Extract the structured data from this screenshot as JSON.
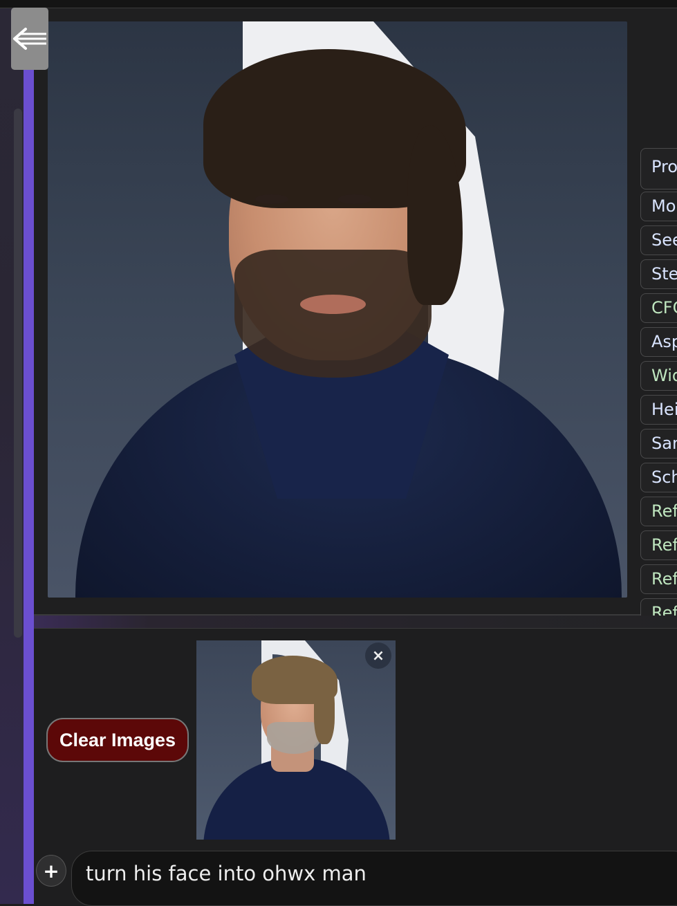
{
  "header": {
    "back_icon": "back-arrow-icon"
  },
  "generated_image": {
    "alt": "Generated portrait of a bearded man in a navy shirt and blazer"
  },
  "params": {
    "labels": [
      "Pro",
      "Mo",
      "See",
      "Ste",
      "CFG",
      "Asp",
      "Wid",
      "Hei",
      "San",
      "Sch",
      "Ref",
      "Ref",
      "Ref",
      "Ref"
    ]
  },
  "actions": {
    "clear_images_label": "Clear Images"
  },
  "attachments": {
    "thumbnail_alt": "Reference portrait of a man with swept-back hair and grey beard",
    "remove_label": "×"
  },
  "prompt": {
    "add_label": "+",
    "value": "turn his face into ohwx man"
  },
  "colors": {
    "accent": "#6b4fd0",
    "clear_button_bg": "#5c0808",
    "label_text": "#d9e4ff",
    "label_text_alt": "#bfe6bf"
  }
}
